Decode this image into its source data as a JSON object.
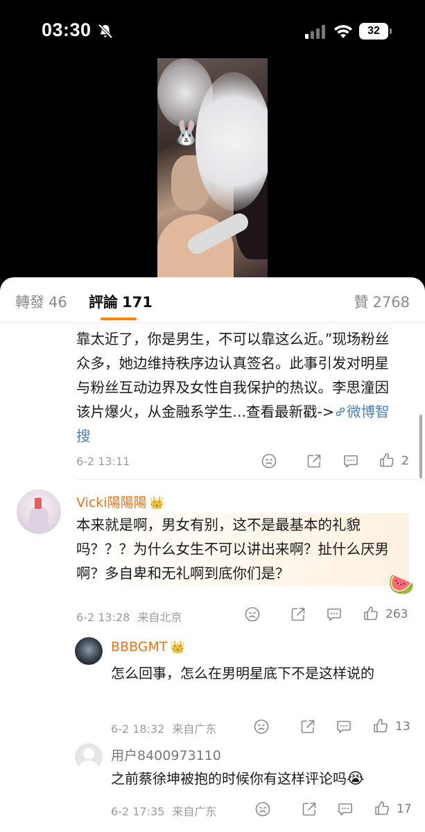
{
  "status_bar": {
    "time": "03:30",
    "battery": "32"
  },
  "video": {
    "watermark": "",
    "overlay_emoji": "🐰"
  },
  "tabs": {
    "repost_label": "轉發",
    "repost_count": "46",
    "comment_label": "評論",
    "comment_count": "171",
    "like_label": "贊",
    "like_count": "2768"
  },
  "comment1": {
    "text": "靠太近了，你是男生，不可以靠这么近。”现场粉丝众多，她边维持秩序边认真签名。此事引发对明星与粉丝互动边界及女性自我保护的热议。李思潼因该片爆火，从金融系学生...查看最新戳->",
    "link": "微博智搜",
    "date": "6-2 13:11",
    "likes": "2"
  },
  "comment2": {
    "username": "Vicki陽陽陽",
    "badge": "👑",
    "text": "本来就是啊，男女有别，这不是最基本的礼貌吗？？？为什么女生不可以讲出来啊？扯什么厌男啊？多自卑和无礼啊到底你们是？",
    "sticker": "🍉",
    "date": "6-2 13:28",
    "location": "来自北京",
    "likes": "263"
  },
  "reply1": {
    "username": "BBBGMT",
    "badge": "👑",
    "text": "怎么回事，怎么在男明星底下不是这样说的",
    "date": "6-2 18:32",
    "location": "来自广东",
    "likes": "13"
  },
  "reply2": {
    "username": "用户8400973110",
    "text": "之前蔡徐坤被抱的时候你有这样评论吗",
    "emoji": "😭",
    "date": "6-2 17:35",
    "location": "来自广东",
    "likes": "17"
  }
}
